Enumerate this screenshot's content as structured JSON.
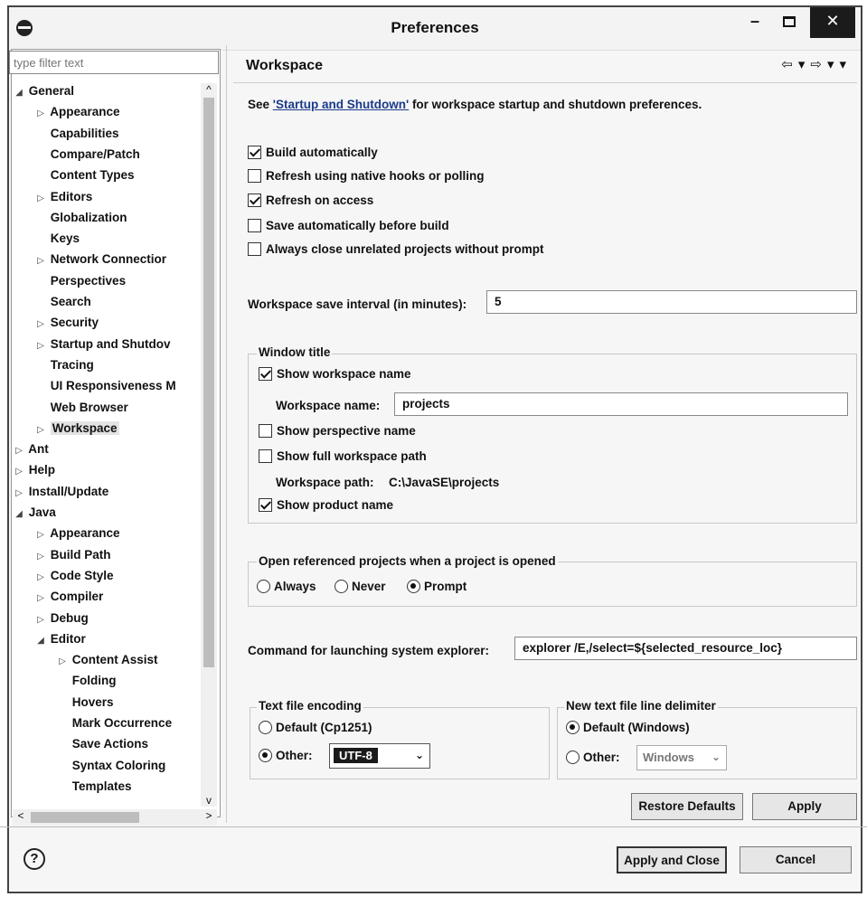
{
  "window": {
    "title": "Preferences",
    "min": "–",
    "close": "✕"
  },
  "filter": {
    "placeholder": "type filter text"
  },
  "tree": [
    {
      "label": "General",
      "twisty": "◢",
      "indent": 0
    },
    {
      "label": "Appearance",
      "twisty": "▷",
      "indent": 1
    },
    {
      "label": "Capabilities",
      "twisty": "",
      "indent": 1
    },
    {
      "label": "Compare/Patch",
      "twisty": "",
      "indent": 1
    },
    {
      "label": "Content Types",
      "twisty": "",
      "indent": 1
    },
    {
      "label": "Editors",
      "twisty": "▷",
      "indent": 1
    },
    {
      "label": "Globalization",
      "twisty": "",
      "indent": 1
    },
    {
      "label": "Keys",
      "twisty": "",
      "indent": 1
    },
    {
      "label": "Network Connectior",
      "twisty": "▷",
      "indent": 1
    },
    {
      "label": "Perspectives",
      "twisty": "",
      "indent": 1
    },
    {
      "label": "Search",
      "twisty": "",
      "indent": 1
    },
    {
      "label": "Security",
      "twisty": "▷",
      "indent": 1
    },
    {
      "label": "Startup and Shutdov",
      "twisty": "▷",
      "indent": 1
    },
    {
      "label": "Tracing",
      "twisty": "",
      "indent": 1
    },
    {
      "label": "UI Responsiveness M",
      "twisty": "",
      "indent": 1
    },
    {
      "label": "Web Browser",
      "twisty": "",
      "indent": 1
    },
    {
      "label": "Workspace",
      "twisty": "▷",
      "indent": 1,
      "selected": true
    },
    {
      "label": "Ant",
      "twisty": "▷",
      "indent": 0
    },
    {
      "label": "Help",
      "twisty": "▷",
      "indent": 0
    },
    {
      "label": "Install/Update",
      "twisty": "▷",
      "indent": 0
    },
    {
      "label": "Java",
      "twisty": "◢",
      "indent": 0
    },
    {
      "label": "Appearance",
      "twisty": "▷",
      "indent": 1
    },
    {
      "label": "Build Path",
      "twisty": "▷",
      "indent": 1
    },
    {
      "label": "Code Style",
      "twisty": "▷",
      "indent": 1
    },
    {
      "label": "Compiler",
      "twisty": "▷",
      "indent": 1
    },
    {
      "label": "Debug",
      "twisty": "▷",
      "indent": 1
    },
    {
      "label": "Editor",
      "twisty": "◢",
      "indent": 1
    },
    {
      "label": "Content Assist",
      "twisty": "▷",
      "indent": 2
    },
    {
      "label": "Folding",
      "twisty": "",
      "indent": 2
    },
    {
      "label": "Hovers",
      "twisty": "",
      "indent": 2
    },
    {
      "label": "Mark Occurrence",
      "twisty": "",
      "indent": 2
    },
    {
      "label": "Save Actions",
      "twisty": "",
      "indent": 2
    },
    {
      "label": "Syntax Coloring",
      "twisty": "",
      "indent": 2
    },
    {
      "label": "Templates",
      "twisty": "",
      "indent": 2
    }
  ],
  "scroll": {
    "up": "^",
    "down": "v",
    "left": "<",
    "right": ">"
  },
  "page": {
    "title": "Workspace",
    "nav": [
      "⇦",
      "▾",
      "⇨",
      "▾",
      "▾"
    ],
    "intro_prefix": "See ",
    "intro_link": "'Startup and Shutdown'",
    "intro_suffix": " for workspace startup and shutdown preferences.",
    "build_auto": {
      "label": "Build automatically",
      "checked": true
    },
    "refresh_native": {
      "label": "Refresh using native hooks or polling",
      "checked": false
    },
    "refresh_access": {
      "label": "Refresh on access",
      "checked": true
    },
    "save_auto": {
      "label": "Save automatically before build",
      "checked": false
    },
    "always_close": {
      "label": "Always close unrelated projects without prompt",
      "checked": false
    },
    "save_interval_label": "Workspace save interval (in minutes):",
    "save_interval_value": "5",
    "window_title": {
      "legend": "Window title",
      "show_ws_name": {
        "label": "Show workspace name",
        "checked": true
      },
      "ws_name_label": "Workspace name:",
      "ws_name_value": "projects",
      "show_perspective": {
        "label": "Show perspective name",
        "checked": false
      },
      "show_full_path": {
        "label": "Show full workspace path",
        "checked": false
      },
      "ws_path_label": "Workspace path:",
      "ws_path_value": "C:\\JavaSE\\projects",
      "show_product": {
        "label": "Show product name",
        "checked": true
      }
    },
    "open_ref": {
      "legend": "Open referenced projects when a project is opened",
      "options": [
        "Always",
        "Never",
        "Prompt"
      ],
      "selected": "Prompt"
    },
    "explorer_label": "Command for launching system explorer:",
    "explorer_value": "explorer /E,/select=${selected_resource_loc}",
    "encoding": {
      "legend": "Text file encoding",
      "default_label": "Default (Cp1251)",
      "other_label": "Other:",
      "selected": "Other",
      "value": "UTF-8"
    },
    "delimiter": {
      "legend": "New text file line delimiter",
      "default_label": "Default (Windows)",
      "other_label": "Other:",
      "selected": "Default",
      "value": "Windows"
    },
    "restore_defaults": "Restore Defaults",
    "apply": "Apply"
  },
  "footer": {
    "help": "?",
    "apply_close": "Apply and Close",
    "cancel": "Cancel"
  }
}
